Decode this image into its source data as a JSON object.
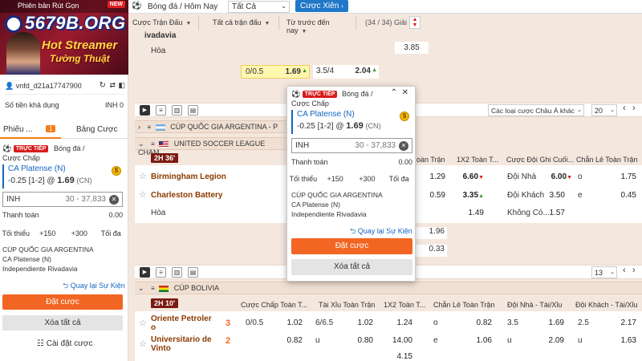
{
  "banner": {
    "top_text": "Phiên bản Rút Gọn",
    "new_badge": "NEW",
    "hot1": "Hot Streamer",
    "hot2": "Tường Thuật",
    "watermark": "5679B.ORG"
  },
  "account": {
    "username": "vnfd_d21a17747900",
    "balance_label": "Số tiền khả dụng",
    "balance_value": "INH 0"
  },
  "sidebar_tabs": {
    "slip": "Phiếu ...",
    "slip_count": "1",
    "board": "Bảng Cược"
  },
  "bet_slip": {
    "live": "TRỰC TIẾP",
    "sport": "Bóng đá /",
    "market": "Cược Chấp",
    "selection": "CA Platense (N)",
    "line": "-0.25 [1-2] @",
    "odds": "1.69",
    "odds_type": "(CN)",
    "stake_currency": "INH",
    "stake_range": "30 - 37,833",
    "payout_label": "Thanh toán",
    "payout_value": "0.00",
    "quick": [
      "Tối thiểu",
      "+150",
      "+300",
      "Tối đa"
    ],
    "league": "CÚP QUỐC GIA ARGENTINA",
    "team1": "CA Platense (N)",
    "team2": "Independiente Rivadavia",
    "back_link": "Quay lại Sự Kiện",
    "place": "Đặt cược",
    "clear": "Xóa tất cả",
    "settings": "Cài đặt cược"
  },
  "topbar": {
    "sport": "Bóng đá / Hôm Nay",
    "filter_all": "Tất Cả",
    "parlay": "Cược Xiên"
  },
  "filters": {
    "f1": "Cược Trận Đấu",
    "f2": "Tất cả trận đấu",
    "f3": "Từ trước đến nay",
    "games": "(34 / 34) Giải"
  },
  "match0": {
    "team": "ivadavia",
    "draw": "Hòa",
    "o1": "3.85",
    "hdp": "0/0.5",
    "hdp_odds": "1.69",
    "ou": "3.5/4",
    "ou_odds": "2.04"
  },
  "toolbar1": {
    "odds_type": "Các loại cược Châu Á khác",
    "per_page": "20"
  },
  "leagues": {
    "arg": "CÚP QUỐC GIA ARGENTINA - P",
    "usl": "UNITED SOCCER LEAGUE CHAM",
    "bol": "CÚP BOLIVIA"
  },
  "match1": {
    "time": "2H 36'",
    "home": "Birmingham Legion",
    "away": "Charleston Battery",
    "draw": "Hòa",
    "headers": [
      "oàn Trận",
      "1X2 Toàn T...",
      "Cược Đội Ghi Cuối...",
      "Chẵn Lẻ Toàn Trận"
    ],
    "r1": {
      "o": "1.29",
      "x": "6.60",
      "team": "Đội Nhà",
      "teamodd": "6.00",
      "oe": "o",
      "oeodd": "1.75"
    },
    "r2": {
      "o": "0.59",
      "x": "3.35",
      "team": "Đội Khách",
      "teamodd": "3.50",
      "oe": "e",
      "oeodd": "0.45"
    },
    "r3": {
      "x": "1.49",
      "team": "Không Có...",
      "teamodd": "1.57"
    },
    "extra1": "1.96",
    "extra2": "0.33"
  },
  "toolbar2": {
    "per_page": "13"
  },
  "match2": {
    "time": "2H 10'",
    "home": "Oriente Petroler o",
    "home_score": "3",
    "away": "Universitario de Vinto",
    "away_score": "2",
    "headers": [
      "Cược Chấp Toàn T...",
      "Tài Xỉu Toàn Trận",
      "1X2 Toàn T...",
      "Chẵn Lẻ Toàn Trận",
      "Đội Nhà - Tài/Xỉu",
      "Đội Khách - Tài/Xỉu"
    ],
    "r1": {
      "hdp": "0/0.5",
      "hdp_odds": "1.02",
      "ou": "6/6.5",
      "ou_odds": "1.02",
      "x": "1.24",
      "oe": "o",
      "oeodd": "0.82",
      "hou": "3.5",
      "houodd": "1.69",
      "aou": "2.5",
      "aouodd": "2.17"
    },
    "r2": {
      "hdp_odds": "0.82",
      "ou": "u",
      "ou_odds": "0.80",
      "x": "14.00",
      "oe": "e",
      "oeodd": "1.06",
      "hou": "u",
      "houodd": "2.09",
      "aou": "u",
      "aouodd": "1.63"
    },
    "r3": {
      "x": "4.15"
    }
  },
  "popup": {
    "live": "TRỰC TIẾP",
    "sport": "Bóng đá /",
    "market": "Cược Chấp",
    "selection": "CA Platense (N)",
    "line": "-0.25 [1-2] @",
    "odds": "1.69",
    "odds_type": "(CN)",
    "stake_currency": "INH",
    "stake_range": "30 - 37,833",
    "payout_label": "Thanh toán",
    "payout_value": "0.00",
    "quick": [
      "Tối thiểu",
      "+150",
      "+300",
      "Tối đa"
    ],
    "league": "CÚP QUỐC GIA ARGENTINA",
    "team1": "CA Platense (N)",
    "team2": "Independiente Rivadavia",
    "back_link": "Quay lại Sự Kiện",
    "place": "Đặt cược",
    "clear": "Xóa tất cả"
  },
  "colors": {
    "accent": "#f26522",
    "blue": "#1565c0",
    "live_red": "#d81b1b",
    "bg": "#f4e7de"
  }
}
